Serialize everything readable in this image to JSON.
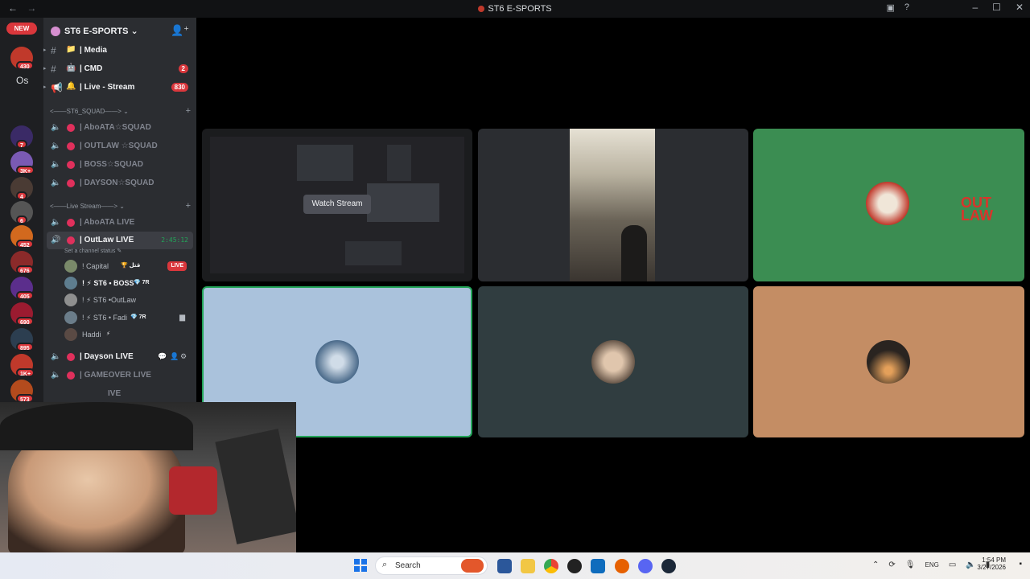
{
  "window": {
    "title": "ST6 E-SPORTS",
    "nav_back": "←",
    "nav_forward": "→"
  },
  "rail": {
    "new_label": "NEW",
    "os_label": "Os",
    "servers": [
      {
        "badge": "430",
        "color": "#c0392b"
      },
      {
        "badge": "",
        "color": "#2b2d31"
      },
      {
        "badge": "7",
        "color": "#3a2a66"
      },
      {
        "badge": "3K+",
        "color": "#7a5ab4"
      },
      {
        "badge": "4",
        "color": "#4a3b34"
      },
      {
        "badge": "6",
        "color": "#555"
      },
      {
        "badge": "452",
        "color": "#d2691e"
      },
      {
        "badge": "676",
        "color": "#8b2a2a"
      },
      {
        "badge": "405",
        "color": "#5b2e8c"
      },
      {
        "badge": "690",
        "color": "#9b1b30"
      },
      {
        "badge": "895",
        "color": "#2c3e50"
      },
      {
        "badge": "1K+",
        "color": "#c0392b"
      },
      {
        "badge": "573",
        "color": "#b34b1d"
      }
    ]
  },
  "sidebar": {
    "server_name": "ST6 E-SPORTS",
    "text_channels": [
      {
        "emoji": "📁",
        "label": "| Media",
        "count": ""
      },
      {
        "emoji": "🤖",
        "label": "| CMD",
        "count": "2"
      },
      {
        "emoji": "🔔",
        "label": "| Live - Stream",
        "count": "830"
      }
    ],
    "category_squad": "<——ST6_SQUAD——>",
    "squad_channels": [
      "| AboATA☆SQUAD",
      "| OUTLAW ☆SQUAD",
      "| BOSS☆SQUAD",
      "| DAYSON☆SQUAD"
    ],
    "category_live": "<——Live Stream——>",
    "live_channels": [
      {
        "label": "| AboATA LIVE"
      },
      {
        "label": "| OutLaw LIVE",
        "timer": "2:45:12"
      }
    ],
    "status_hint": "Set a channel status ✎",
    "members": [
      {
        "name": "! Capital",
        "tag": "🏆 قتل",
        "live": "LIVE"
      },
      {
        "name": "! ⚡ ST6 • BOSS",
        "tag": "💎 7R"
      },
      {
        "name": "! ⚡ ST6 •OutLaw",
        "tag": ""
      },
      {
        "name": "! ⚡ ST6 • Fadi",
        "tag": "💎 7R",
        "cam": "▆"
      },
      {
        "name": "Haddi",
        "tag": "⚡"
      }
    ],
    "other_channels": [
      "| Dayson LIVE",
      "| GAMEOVER LIVE",
      "IVE"
    ]
  },
  "stage": {
    "watch_stream_label": "Watch Stream",
    "tiles": [
      {
        "kind": "stream",
        "bg": "#1b1c1e"
      },
      {
        "kind": "video",
        "bg": "#2b2d31"
      },
      {
        "kind": "avatar",
        "bg": "#3b8d52",
        "brand": "OUT LAW"
      },
      {
        "kind": "avatar",
        "bg": "#aac2dc",
        "speaking": true
      },
      {
        "kind": "avatar",
        "bg": "#303d40"
      },
      {
        "kind": "avatar",
        "bg": "#c48d64"
      }
    ]
  },
  "taskbar": {
    "search_placeholder": "Search",
    "lang": "ENG",
    "time": "1:54 PM",
    "date": "3/27/2026"
  }
}
